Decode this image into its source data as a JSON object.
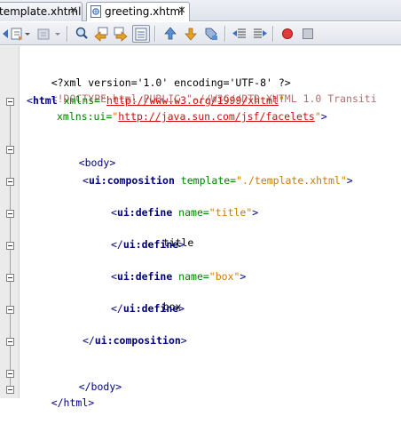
{
  "tabs": [
    {
      "label": "template.xhtml",
      "active": false
    },
    {
      "label": "greeting.xhtml",
      "active": true
    }
  ],
  "close_glyph": "✕",
  "toolbar": {
    "buttons": [
      "back-icon",
      "forward-history-icon",
      "dropdown-icon",
      "find-icon",
      "find-previous-icon",
      "find-next-icon",
      "toggle-highlight-icon",
      "previous-bookmark-icon",
      "next-bookmark-icon",
      "toggle-bookmark-icon",
      "shift-left-icon",
      "shift-right-icon",
      "record-macro-icon",
      "stop-macro-icon"
    ]
  },
  "code": {
    "l1": {
      "t": "<?xml version='1.0' encoding='UTF-8' ?>"
    },
    "l2": {
      "t": "<!DOCTYPE html PUBLIC \"-//W3C//DTD XHTML 1.0 Transiti"
    },
    "l3": {
      "open": "<",
      "tag": "html",
      "attr": " xmlns=",
      "q1": "\"",
      "url": "http://www.w3.org/1999/xhtml",
      "q2": "\""
    },
    "l4": {
      "attr": "xmlns:ui=",
      "q1": "\"",
      "url": "http://java.sun.com/jsf/facelets",
      "q2": "\"",
      "close": ">"
    },
    "l5": {
      "t": "<body>"
    },
    "l6": {
      "open": "<",
      "tag": "ui:composition",
      "attr": " template=",
      "val": "\"./template.xhtml\"",
      "close": ">"
    },
    "l7": {
      "open": "<",
      "tag": "ui:define",
      "attr": " name=",
      "val": "\"title\"",
      "close": ">"
    },
    "l8": {
      "t": "title"
    },
    "l9": {
      "open": "</",
      "tag": "ui:define",
      "close": ">"
    },
    "l10": {
      "open": "<",
      "tag": "ui:define",
      "attr": " name=",
      "val": "\"box\"",
      "close": ">"
    },
    "l11": {
      "t": "box"
    },
    "l12": {
      "open": "</",
      "tag": "ui:define",
      "close": ">"
    },
    "l13": {
      "open": "</",
      "tag": "ui:composition",
      "close": ">"
    },
    "l14": {
      "t": "</body>"
    },
    "l15": {
      "t": "</html>"
    }
  }
}
